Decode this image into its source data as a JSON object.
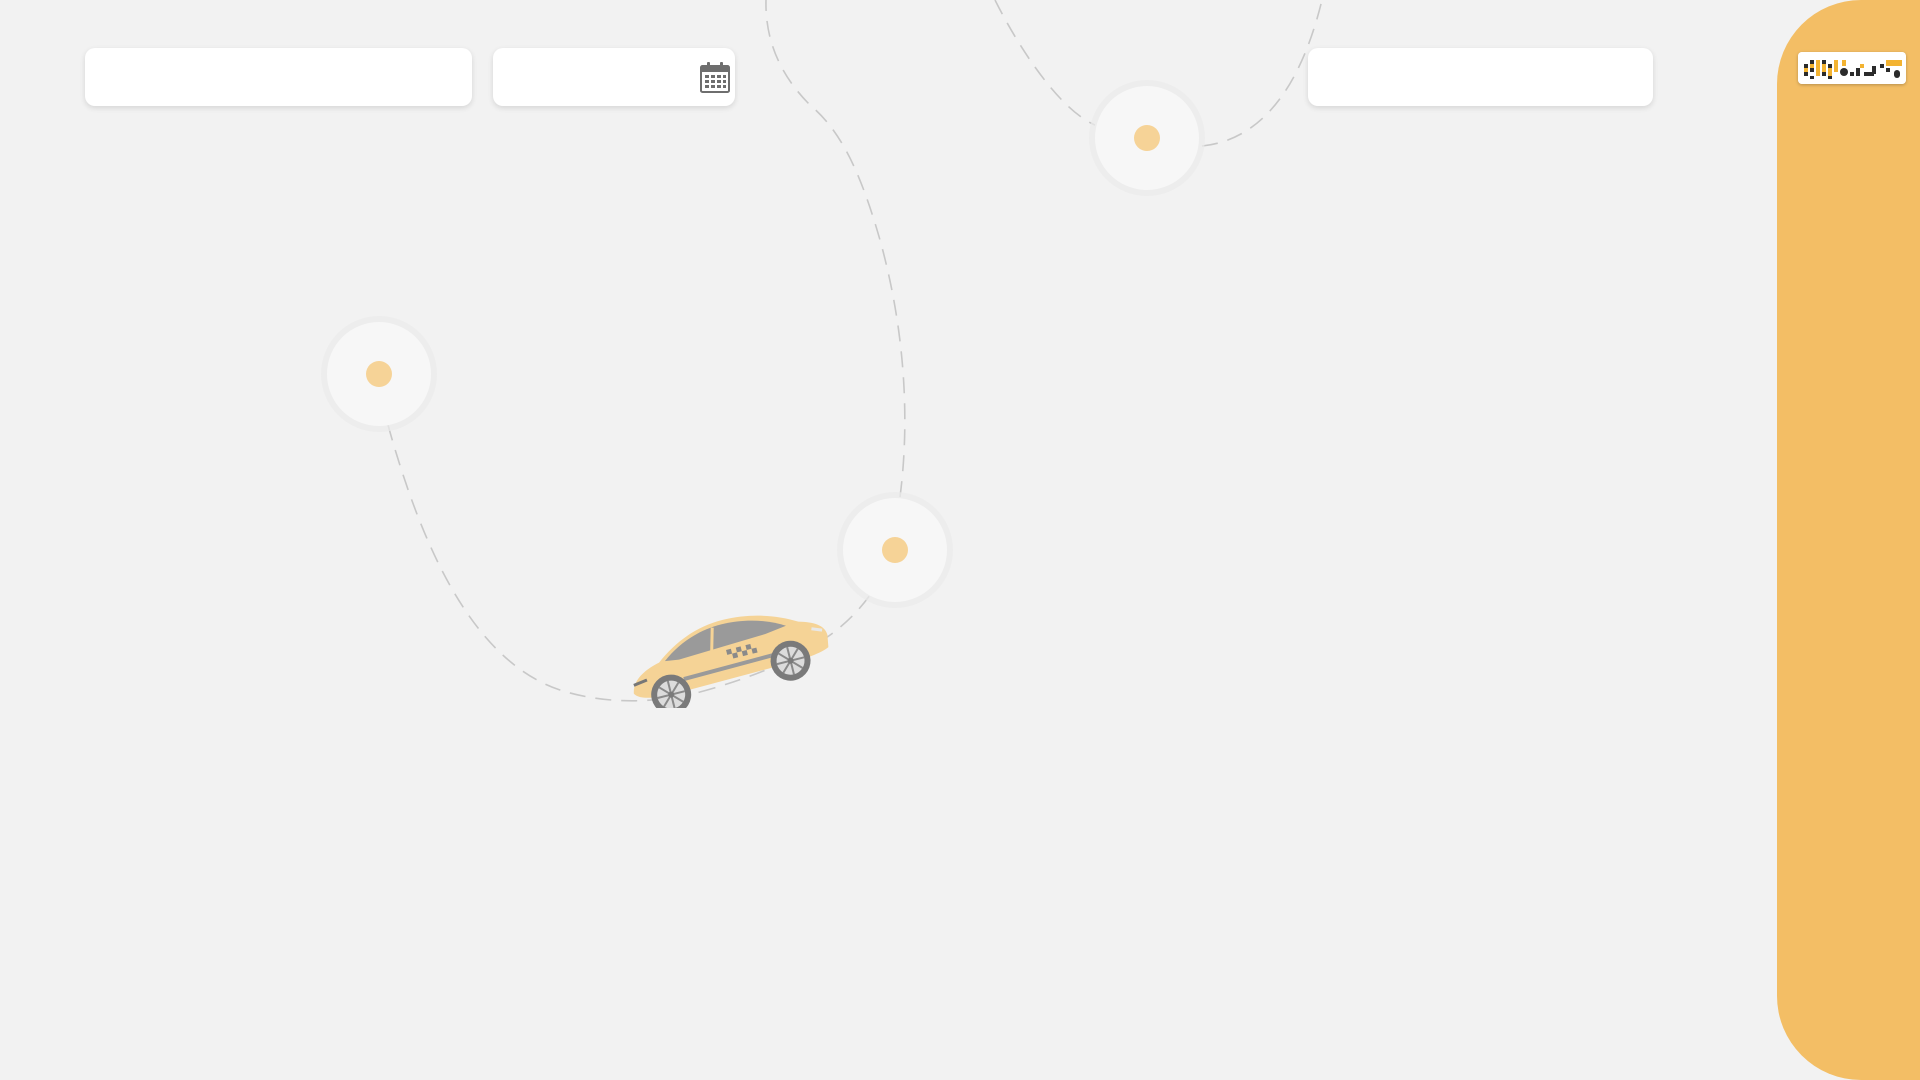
{
  "trip_form": {
    "origin_field": {
      "value": "",
      "placeholder": ""
    },
    "date_field": {
      "value": "",
      "placeholder": ""
    },
    "destination_field": {
      "value": "",
      "placeholder": ""
    }
  },
  "icons": {
    "calendar": "calendar-icon",
    "logo": "brand-logo",
    "vehicle": "taxi-car"
  },
  "colors": {
    "background": "#f2f2f2",
    "accent": "#f3be65",
    "stop_dot": "#f6d397",
    "route_dash": "#c8c8c8",
    "taxi_body": "#f5d396",
    "taxi_trim": "#9a9a9a"
  }
}
